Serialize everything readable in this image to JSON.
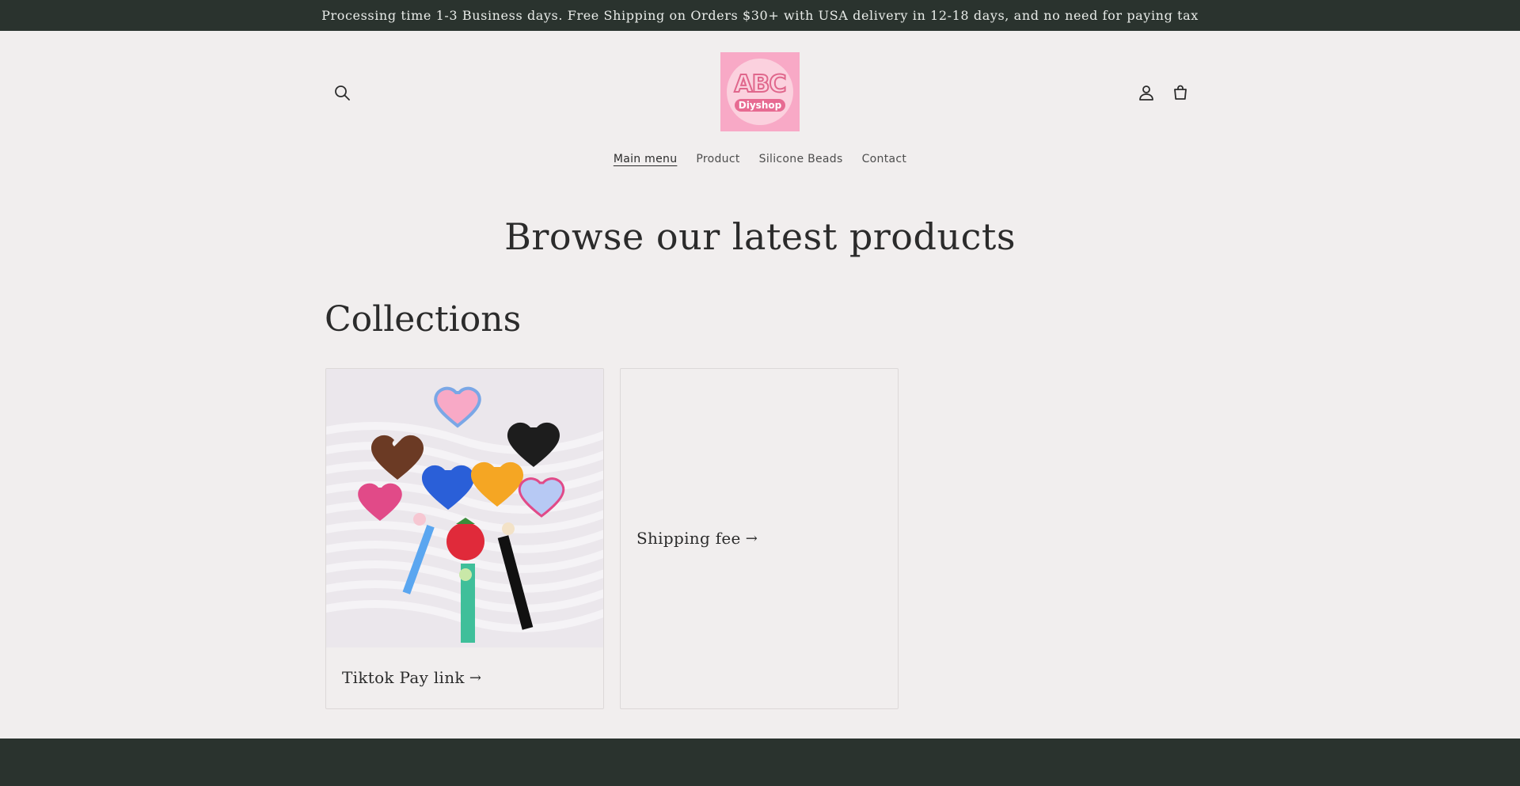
{
  "announcement": {
    "text": "Processing time 1-3 Business days. Free Shipping on Orders $30+ with USA delivery in 12-18 days, and no need for paying tax"
  },
  "header": {
    "logo_text": "ABC",
    "logo_sub": "Diyshop",
    "icons": {
      "search": "search-icon",
      "account": "account-icon",
      "cart": "cart-icon"
    }
  },
  "nav": {
    "items": [
      {
        "label": "Main menu",
        "active": true
      },
      {
        "label": "Product",
        "active": false
      },
      {
        "label": "Silicone Beads",
        "active": false
      },
      {
        "label": "Contact",
        "active": false
      }
    ]
  },
  "main": {
    "hero_title": "Browse our latest products",
    "collections_title": "Collections",
    "collections": [
      {
        "label": "Tiktok Pay link",
        "arrow": "→",
        "has_image": true
      },
      {
        "label": "Shipping fee",
        "arrow": "→",
        "has_image": false
      }
    ]
  },
  "colors": {
    "announcement_bg": "#2a332e",
    "page_bg": "#f1eeee",
    "logo_bg": "#f8a9c6",
    "footer_bg": "#2a332e"
  }
}
